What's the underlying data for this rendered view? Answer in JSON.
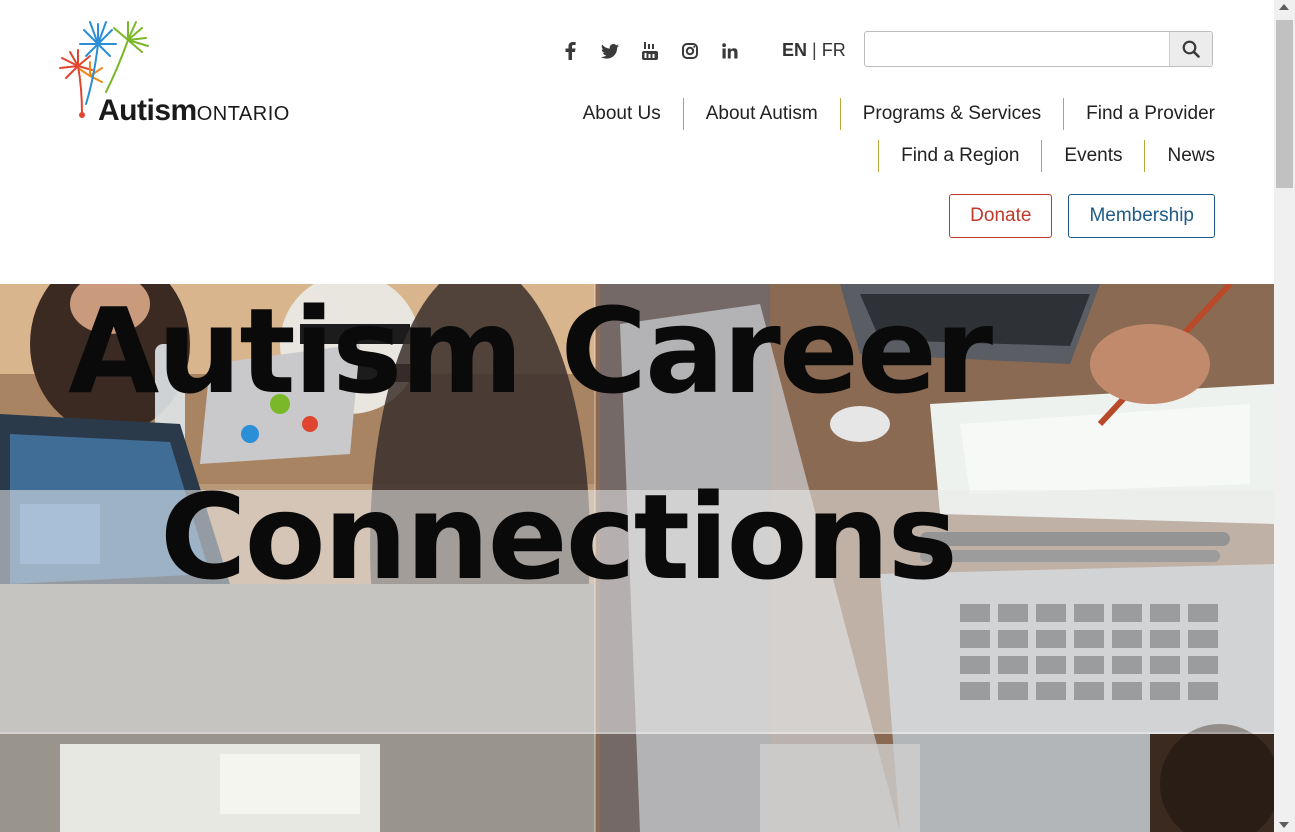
{
  "logo": {
    "word1": "Autism",
    "word2": "ONTARIO"
  },
  "social": [
    {
      "name": "facebook-icon"
    },
    {
      "name": "twitter-icon"
    },
    {
      "name": "youtube-icon"
    },
    {
      "name": "instagram-icon"
    },
    {
      "name": "linkedin-icon"
    }
  ],
  "lang": {
    "en": "EN",
    "sep": "|",
    "fr": "FR"
  },
  "search": {
    "placeholder": "",
    "value": "",
    "icon": "search-icon"
  },
  "nav": {
    "row1": [
      "About Us",
      "About Autism",
      "Programs & Services",
      "Find a Provider"
    ],
    "row2": [
      "Find a Region",
      "Events",
      "News"
    ]
  },
  "actions": {
    "donate": "Donate",
    "membership": "Membership"
  },
  "hero": {
    "line1": "Autism Career",
    "line2": "Connections"
  },
  "colors": {
    "donate": "#c0392b",
    "membership": "#1f5a86",
    "nav_divider": "#b9a838"
  }
}
